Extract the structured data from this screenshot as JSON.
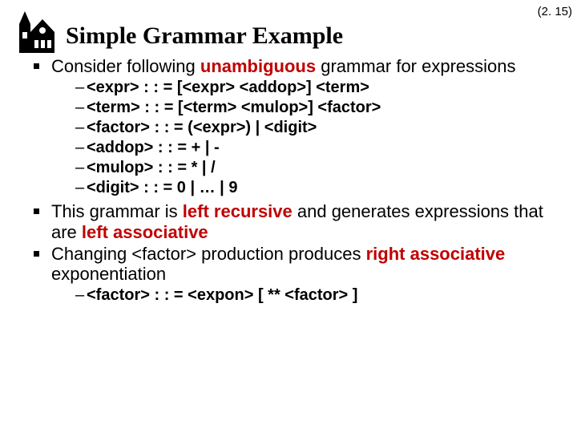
{
  "slideNumber": "(2. 15)",
  "title": "Simple Grammar Example",
  "bullet1_a": "Consider following ",
  "bullet1_b": "unambiguous",
  "bullet1_c": " grammar for expressions",
  "grammar": [
    "<expr> : : = [<expr> <addop>] <term>",
    "<term> : : = [<term> <mulop>] <factor>",
    "<factor> : : = (<expr>) | <digit>",
    "<addop> : : = + | -",
    "<mulop> : : = * | /",
    "<digit> : : = 0 | … | 9"
  ],
  "bullet2_a": "This grammar is ",
  "bullet2_b": "left recursive",
  "bullet2_c": " and generates expressions that are ",
  "bullet2_d": "left associative",
  "bullet3_a": "Changing <factor> production produces ",
  "bullet3_b": "right associative",
  "bullet3_c": " exponentiation",
  "grammar2": "<factor> : : = <expon> [ ** <factor> ]"
}
